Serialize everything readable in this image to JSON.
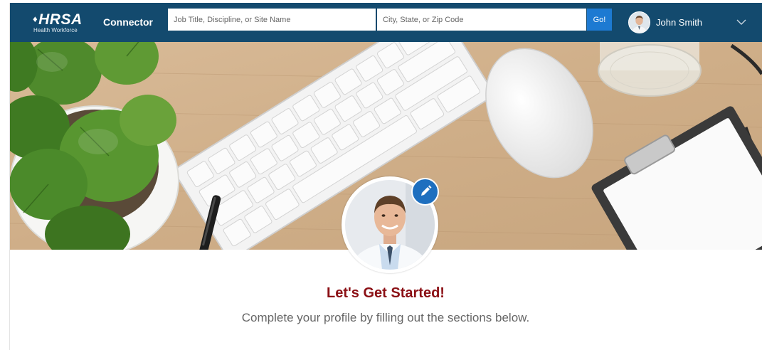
{
  "header": {
    "logo_text": "HRSA",
    "logo_subtext": "Health Workforce",
    "app_name": "Connector",
    "job_search": {
      "placeholder": "Job Title, Discipline, or Site Name",
      "value": ""
    },
    "location_search": {
      "placeholder": "City, State, or Zip Code",
      "value": ""
    },
    "go_label": "Go!",
    "user": {
      "name": "John Smith"
    }
  },
  "profile": {
    "title": "Let's Get Started!",
    "subtitle": "Complete your profile by filling out the sections below."
  },
  "colors": {
    "header_bg": "#134a6e",
    "go_button": "#1d7ad2",
    "edit_button": "#1e6fbf",
    "headline": "#8b1015",
    "subtitle": "#666666"
  },
  "icons": {
    "logo": "hrsa-logo-icon",
    "edit": "pencil-icon",
    "menu": "chevron-down-icon"
  }
}
